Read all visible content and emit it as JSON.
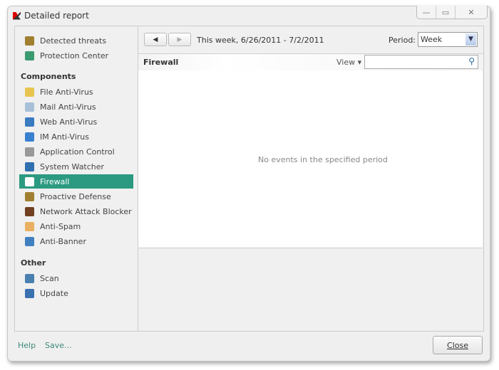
{
  "window": {
    "title": "Detailed report",
    "minimize": "—",
    "maximize": "▭",
    "close": "✕"
  },
  "sidebar": {
    "top_items": [
      {
        "label": "Detected threats",
        "icon": "shield-icon",
        "color": "#a08030"
      },
      {
        "label": "Protection Center",
        "icon": "shield-green-icon",
        "color": "#3a9a70"
      }
    ],
    "components_heading": "Components",
    "components": [
      {
        "label": "File Anti-Virus",
        "icon": "folder-icon",
        "color": "#e8c550"
      },
      {
        "label": "Mail Anti-Virus",
        "icon": "mail-icon",
        "color": "#a8c0d8"
      },
      {
        "label": "Web Anti-Virus",
        "icon": "globe-icon",
        "color": "#3a7ac0"
      },
      {
        "label": "IM Anti-Virus",
        "icon": "chat-icon",
        "color": "#3a80d0"
      },
      {
        "label": "Application Control",
        "icon": "funnel-icon",
        "color": "#999999"
      },
      {
        "label": "System Watcher",
        "icon": "monitor-icon",
        "color": "#3070b0"
      },
      {
        "label": "Firewall",
        "icon": "firewall-icon",
        "color": "#ffffff",
        "selected": true
      },
      {
        "label": "Proactive Defense",
        "icon": "shield-icon",
        "color": "#a08030"
      },
      {
        "label": "Network Attack Blocker",
        "icon": "network-icon",
        "color": "#704020"
      },
      {
        "label": "Anti-Spam",
        "icon": "spam-icon",
        "color": "#e8b060"
      },
      {
        "label": "Anti-Banner",
        "icon": "banner-icon",
        "color": "#4080c0"
      }
    ],
    "other_heading": "Other",
    "other": [
      {
        "label": "Scan",
        "icon": "scan-icon",
        "color": "#4a80b0"
      },
      {
        "label": "Update",
        "icon": "update-icon",
        "color": "#3a70b0"
      }
    ]
  },
  "toolbar": {
    "prev": "◀",
    "next": "▶",
    "range": "This week, 6/26/2011 - 7/2/2011",
    "period_label": "Period:",
    "period_value": "Week"
  },
  "section": {
    "title": "Firewall",
    "view_label": "View ▾",
    "search_placeholder": ""
  },
  "content": {
    "empty_message": "No events in the specified period"
  },
  "footer": {
    "help": "Help",
    "save": "Save...",
    "close": "Close"
  }
}
